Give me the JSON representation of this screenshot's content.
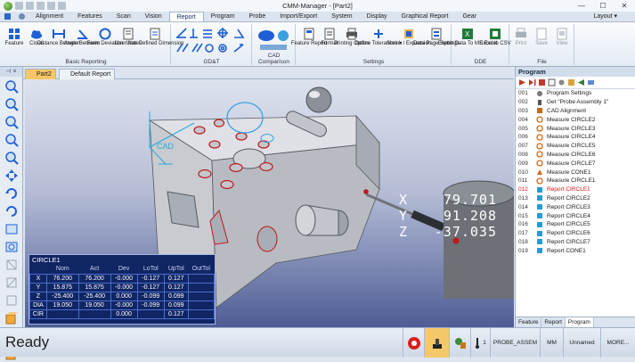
{
  "app": {
    "title": "CMM-Manager - [Part2]",
    "layout_label": "Layout ▾"
  },
  "menu": {
    "tabs": [
      "Alignment",
      "Features",
      "Scan",
      "Vision",
      "Report",
      "Program",
      "Probe",
      "Import/Export",
      "System",
      "Display",
      "Graphical Report",
      "Gear"
    ],
    "active": "Report"
  },
  "ribbon": {
    "groups": [
      {
        "label": "Basic Reporting",
        "buttons": [
          "Feature",
          "Cloud",
          "Distance Between",
          "Angle Between",
          "Form Deviation",
          "User Notes",
          "User Defined Dimension"
        ]
      },
      {
        "label": "GD&T",
        "buttons": []
      },
      {
        "label": "CAD Comparison",
        "buttons": []
      },
      {
        "label": "Settings",
        "buttons": [
          "Feature Report",
          "Format",
          "Printing Option",
          "Define Tolerances ▾",
          "Shrink / Expansion",
          "Data Page Settings"
        ]
      },
      {
        "label": "DDE",
        "buttons": [
          "Export Data To MS Excel",
          "Excel to CSV"
        ]
      },
      {
        "label": "File",
        "buttons": [
          "Print",
          "Save",
          "View"
        ]
      }
    ]
  },
  "doc_tabs": {
    "active": "Part2",
    "inactive": "Default Report"
  },
  "viewport": {
    "cad_label": "CAD"
  },
  "result": {
    "title": "CIRCLE1",
    "headers": [
      "",
      "Nom",
      "Act",
      "Dev",
      "LoTol",
      "UpTol",
      "OutTol"
    ],
    "rows": [
      [
        "X",
        "76.200",
        "76.200",
        "-0.000",
        "-0.127",
        "0.127",
        ""
      ],
      [
        "Y",
        "15.875",
        "15.875",
        "-0.000",
        "-0.127",
        "0.127",
        ""
      ],
      [
        "Z",
        "-25.400",
        "-25.400",
        "0.000",
        "-0.099",
        "0.099",
        ""
      ],
      [
        "DIA",
        "19.050",
        "19.050",
        "-0.000",
        "-0.099",
        "0.099",
        ""
      ],
      [
        "CIR",
        "",
        "",
        "0.000",
        "",
        "0.127",
        ""
      ]
    ]
  },
  "coords": {
    "x_label": "X",
    "y_label": "Y",
    "z_label": "Z",
    "x": "79.701",
    "y": "91.208",
    "z": "-37.035"
  },
  "program": {
    "title": "Program",
    "selected": "012",
    "items": [
      {
        "num": "001",
        "text": "Program Settings",
        "icon": "settings-icon"
      },
      {
        "num": "002",
        "text": "Get \"Probe Assembly 1\"",
        "icon": "probe-icon"
      },
      {
        "num": "003",
        "text": "CAD Alignment",
        "icon": "alignment-icon"
      },
      {
        "num": "004",
        "text": "Measure CIRCLE2",
        "icon": "circle-icon"
      },
      {
        "num": "005",
        "text": "Measure CIRCLE3",
        "icon": "circle-icon"
      },
      {
        "num": "006",
        "text": "Measure CIRCLE4",
        "icon": "circle-icon"
      },
      {
        "num": "007",
        "text": "Measure CIRCLE5",
        "icon": "circle-icon"
      },
      {
        "num": "008",
        "text": "Measure CIRCLE6",
        "icon": "circle-icon"
      },
      {
        "num": "009",
        "text": "Measure CIRCLE7",
        "icon": "circle-icon"
      },
      {
        "num": "010",
        "text": "Measure CONE1",
        "icon": "cone-icon"
      },
      {
        "num": "011",
        "text": "Measure CIRCLE1",
        "icon": "circle-icon"
      },
      {
        "num": "012",
        "text": "Report CIRCLE1",
        "icon": "report-icon"
      },
      {
        "num": "013",
        "text": "Report CIRCLE2",
        "icon": "report-icon"
      },
      {
        "num": "014",
        "text": "Report CIRCLE3",
        "icon": "report-icon"
      },
      {
        "num": "015",
        "text": "Report CIRCLE4",
        "icon": "report-icon"
      },
      {
        "num": "016",
        "text": "Report CIRCLE5",
        "icon": "report-icon"
      },
      {
        "num": "017",
        "text": "Report CIRCLE6",
        "icon": "report-icon"
      },
      {
        "num": "018",
        "text": "Report CIRCLE7",
        "icon": "report-icon"
      },
      {
        "num": "019",
        "text": "Report CONE1",
        "icon": "report-icon"
      }
    ],
    "tabs": [
      "Feature",
      "Report",
      "Program"
    ],
    "active_tab": "Program"
  },
  "status": {
    "ready": "Ready",
    "probe_count": "1",
    "probe_name": "PROBE_ASSEM",
    "units": "MM",
    "part_name": "Unnamed",
    "more": "MORE..."
  },
  "colors": {
    "accent": "#1f5fd6",
    "selected": "#d01515",
    "result_bg": "#102563"
  }
}
